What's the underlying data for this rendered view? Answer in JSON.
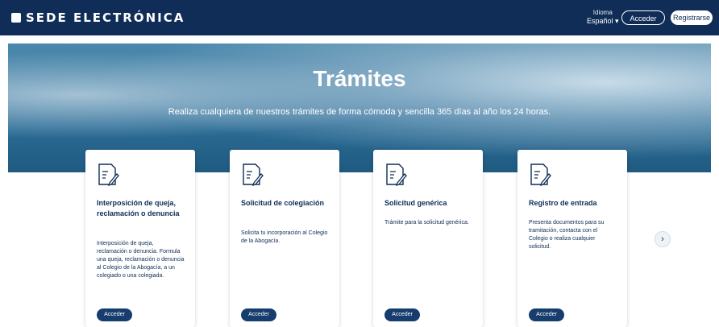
{
  "header": {
    "brand": "SEDE ELECTRÓNICA",
    "language_label": "Idioma",
    "language_value": "Español ▾",
    "access_label": "Acceder",
    "register_label": "Registrarse"
  },
  "hero": {
    "title": "Trámites",
    "subtitle": "Realiza cualquiera de nuestros trámites de forma cómoda y sencilla 365 días al año los 24 horas."
  },
  "cards": [
    {
      "title": "Interposición de queja, reclamación o denuncia",
      "description": "Interposición de queja, reclamación o denuncia. Formula una queja, reclamación o denuncia al Colegio de la Abogacía, a un colegiado o una colegiada.",
      "button": "Acceder"
    },
    {
      "title": "Solicitud de colegiación",
      "description": "Solicita tu incorporación al Colegio de la Abogacía.",
      "button": "Acceder"
    },
    {
      "title": "Solicitud genérica",
      "description": "Trámite para la solicitud genérica.",
      "button": "Acceder"
    },
    {
      "title": "Registro de entrada",
      "description": "Presenta documentos para su tramitación, contacta con el Colegio o realiza cualquier solicitud.",
      "button": "Acceder"
    }
  ],
  "carousel": {
    "next_icon": "›"
  },
  "colors": {
    "navbar": "#0f2d57",
    "button": "#163d6e",
    "card_text": "#0f2d57"
  },
  "icons": {
    "card_icon": "document-pen-icon",
    "carousel_next": "chevron-right-icon"
  }
}
